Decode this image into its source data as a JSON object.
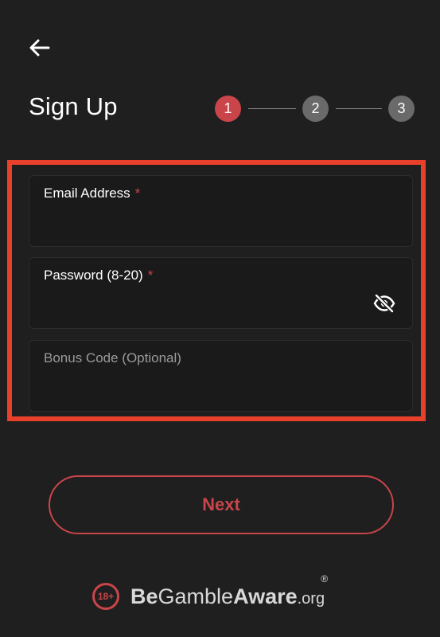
{
  "header": {
    "back_icon": "arrow-left-icon",
    "title": "Sign Up"
  },
  "stepper": {
    "steps": [
      {
        "label": "1",
        "state": "active"
      },
      {
        "label": "2",
        "state": "inactive"
      },
      {
        "label": "3",
        "state": "inactive"
      }
    ],
    "active_color": "#c9454a",
    "inactive_color": "#6a6a6a"
  },
  "form": {
    "email": {
      "label": "Email Address",
      "required_mark": "*",
      "value": ""
    },
    "password": {
      "label": "Password (8-20)",
      "required_mark": "*",
      "value": "",
      "toggle_icon": "eye-off-icon"
    },
    "bonus": {
      "label": "Bonus Code (Optional)",
      "value": ""
    }
  },
  "actions": {
    "next_label": "Next"
  },
  "footer": {
    "age_badge": "18+",
    "brand_be": "Be",
    "brand_gamble": "Gamble",
    "brand_aware": "Aware",
    "brand_org": ".org",
    "registered_mark": "®"
  },
  "colors": {
    "background": "#1f1f1f",
    "accent": "#c9454a",
    "highlight_border": "#e8402a"
  }
}
